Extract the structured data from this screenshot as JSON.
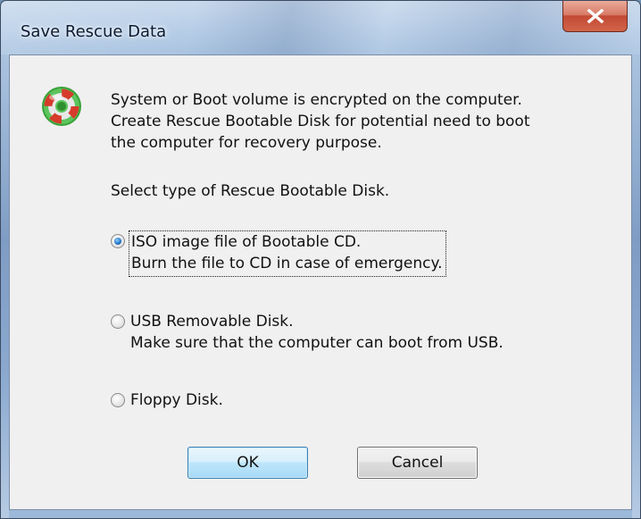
{
  "window": {
    "title": "Save Rescue Data",
    "close_glyph": "X"
  },
  "icon": "rescue-lifebuoy-icon",
  "message": {
    "lines": [
      "System or Boot volume is encrypted on the computer.",
      "Create Rescue Bootable Disk for potential need to boot",
      "the computer for recovery purpose."
    ]
  },
  "select_label": "Select type of Rescue Bootable Disk.",
  "options": [
    {
      "line1": "ISO image file of Bootable CD.",
      "line2": "Burn the file to CD in case of emergency.",
      "checked": true
    },
    {
      "line1": "USB Removable Disk.",
      "line2": "Make sure that the computer can boot from USB.",
      "checked": false
    },
    {
      "line1": "Floppy Disk.",
      "line2": "",
      "checked": false
    }
  ],
  "buttons": {
    "ok": "OK",
    "cancel": "Cancel"
  },
  "colors": {
    "close_button": "#c24a34",
    "selected_radio": "#1f6fc4",
    "default_button_border": "#3c7fb1"
  }
}
